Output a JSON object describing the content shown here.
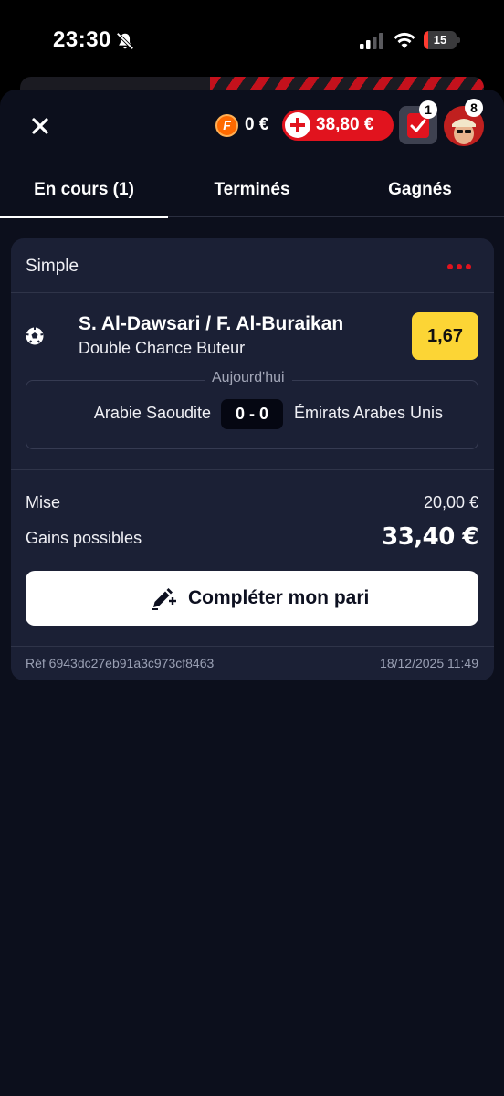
{
  "status_bar": {
    "time": "23:30",
    "battery_level": "15",
    "battery_fraction": 0.15
  },
  "header": {
    "freebet_amount": "0 €",
    "balance": "38,80 €",
    "betslip_count": "1",
    "notifications_count": "8"
  },
  "tabs": [
    {
      "label": "En cours (1)",
      "active": true
    },
    {
      "label": "Terminés",
      "active": false
    },
    {
      "label": "Gagnés",
      "active": false
    }
  ],
  "bet": {
    "type": "Simple",
    "selection": "S. Al-Dawsari / F. Al-Buraikan",
    "market": "Double Chance Buteur",
    "odds": "1,67",
    "match_date": "Aujourd'hui",
    "home_team": "Arabie Saoudite",
    "score": "0 - 0",
    "away_team": "Émirats Arabes Unis",
    "stake_label": "Mise",
    "stake_value": "20,00 €",
    "gains_label": "Gains possibles",
    "gains_value": "33,40 €",
    "complete_label": "Compléter mon pari",
    "reference": "Réf 6943dc27eb91a3c973cf8463",
    "placed_at": "18/12/2025 11:49"
  },
  "colors": {
    "background": "#0c0f1c",
    "card": "#1b2035",
    "accent_red": "#e1131e",
    "odds_yellow": "#fcd535",
    "coin_orange": "#ff6a00"
  },
  "icons": [
    "bell-slash-icon",
    "signal-icon",
    "wifi-icon",
    "close-icon",
    "freebet-coin-icon",
    "plus-icon",
    "betslip-check-icon",
    "avatar",
    "more-dots-icon",
    "soccer-ball-icon",
    "pencil-plus-icon"
  ]
}
